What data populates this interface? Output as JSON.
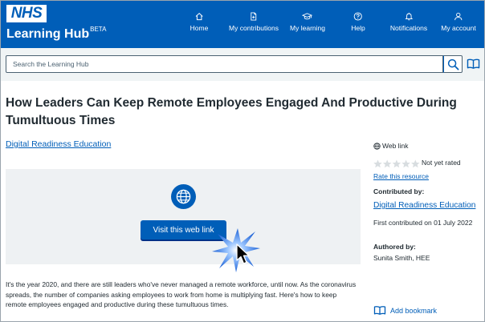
{
  "header": {
    "logo_text": "NHS",
    "app_title": "Learning Hub",
    "app_badge": "BETA",
    "nav": [
      {
        "label": "Home",
        "icon": "home-icon"
      },
      {
        "label": "My contributions",
        "icon": "document-icon"
      },
      {
        "label": "My learning",
        "icon": "graduation-cap-icon"
      },
      {
        "label": "Help",
        "icon": "question-icon"
      },
      {
        "label": "Notifications",
        "icon": "bell-icon"
      },
      {
        "label": "My account",
        "icon": "user-icon"
      }
    ]
  },
  "search": {
    "placeholder": "Search the Learning Hub",
    "value": "",
    "button_icon": "search-icon",
    "catalogue_icon": "open-book-icon"
  },
  "resource": {
    "title": "How Leaders Can Keep Remote Employees Engaged And Productive During Tumultuous Times",
    "catalogue": "Digital Readiness Education",
    "panel_icon": "globe-icon",
    "visit_button": "Visit this web link",
    "description": "It's the year 2020, and there are still leaders who've never managed a remote workforce, until now. As the coronavirus spreads, the number of companies asking employees to work from home is multiplying fast. Here's how to keep remote employees engaged and productive during these tumultuous times."
  },
  "sidebar": {
    "resource_type": "Web link",
    "rating": {
      "stars_filled": 0,
      "stars_total": 5,
      "text": "Not yet rated"
    },
    "rate_link": "Rate this resource",
    "contributed_label": "Contributed by:",
    "contributor": "Digital Readiness Education",
    "first_contributed": "First contributed on 01 July 2022",
    "authored_label": "Authored by:",
    "author": "Sunita Smith, HEE",
    "bookmark": "Add bookmark"
  },
  "colors": {
    "brand_blue": "#005eb8",
    "panel_bg": "#eef1f3",
    "search_bg": "#f0f4f5",
    "text": "#212b32"
  }
}
